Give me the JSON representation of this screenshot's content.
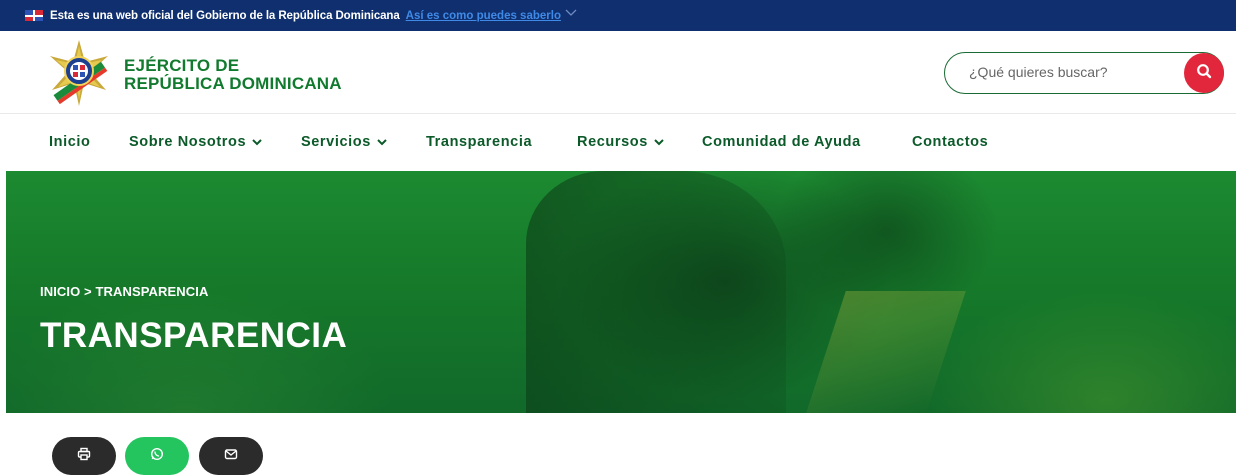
{
  "gov_banner": {
    "text": "Esta es una web oficial del Gobierno de la República Dominicana",
    "link": "Así es como puedes saberlo"
  },
  "header": {
    "brand_line1": "EJÉRCITO DE",
    "brand_line2": "REPÚBLICA DOMINICANA",
    "search_placeholder": "¿Qué quieres buscar?"
  },
  "nav": {
    "items": [
      {
        "label": "Inicio",
        "dropdown": false
      },
      {
        "label": "Sobre Nosotros",
        "dropdown": true
      },
      {
        "label": "Servicios",
        "dropdown": true
      },
      {
        "label": "Transparencia",
        "dropdown": false
      },
      {
        "label": "Recursos",
        "dropdown": true
      },
      {
        "label": "Comunidad de Ayuda",
        "dropdown": false
      },
      {
        "label": "Contactos",
        "dropdown": false
      }
    ]
  },
  "hero": {
    "breadcrumb": "INICIO > TRANSPARENCIA",
    "title": "TRANSPARENCIA"
  },
  "share": {
    "icons": [
      "print-icon",
      "whatsapp-icon",
      "mail-icon"
    ]
  },
  "colors": {
    "gov_bar": "#0f2f6e",
    "brand_green": "#127a2f",
    "nav_text": "#0c5a2a",
    "search_button": "#e2263b",
    "whatsapp": "#24c45f",
    "dark_button": "#2b2b2b"
  }
}
